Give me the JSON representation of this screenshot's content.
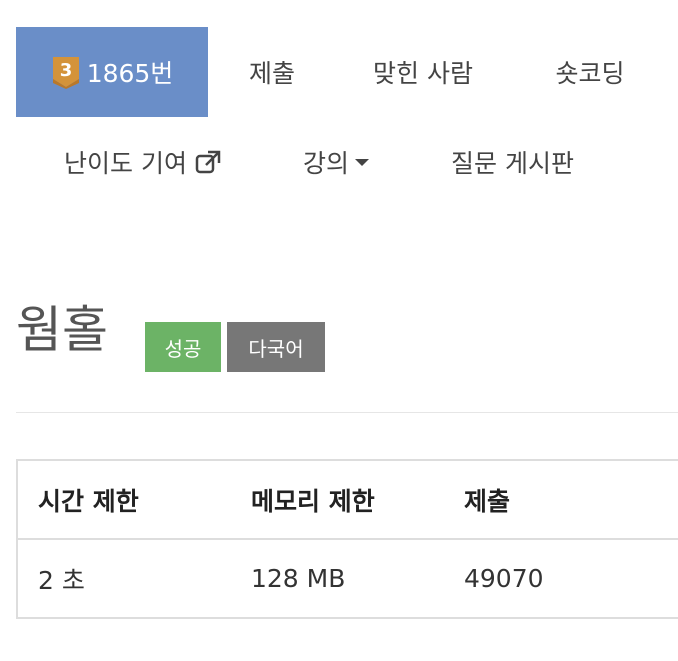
{
  "nav": {
    "problem_number": "1865번",
    "badge_level": "3",
    "submit": "제출",
    "solved_users": "맞힌 사람",
    "short_coding": "숏코딩",
    "difficulty_contribution": "난이도 기여",
    "lectures": "강의",
    "qna_board": "질문 게시판",
    "active_color": "#6a8ec8",
    "badge_color": "#d4933a"
  },
  "problem": {
    "title": "웜홀",
    "label_success": "성공",
    "label_multilang": "다국어",
    "success_color": "#6cb366"
  },
  "info_table": {
    "headers": [
      "시간 제한",
      "메모리 제한",
      "제출"
    ],
    "rows": [
      [
        "2 초",
        "128 MB",
        "49070"
      ]
    ]
  }
}
